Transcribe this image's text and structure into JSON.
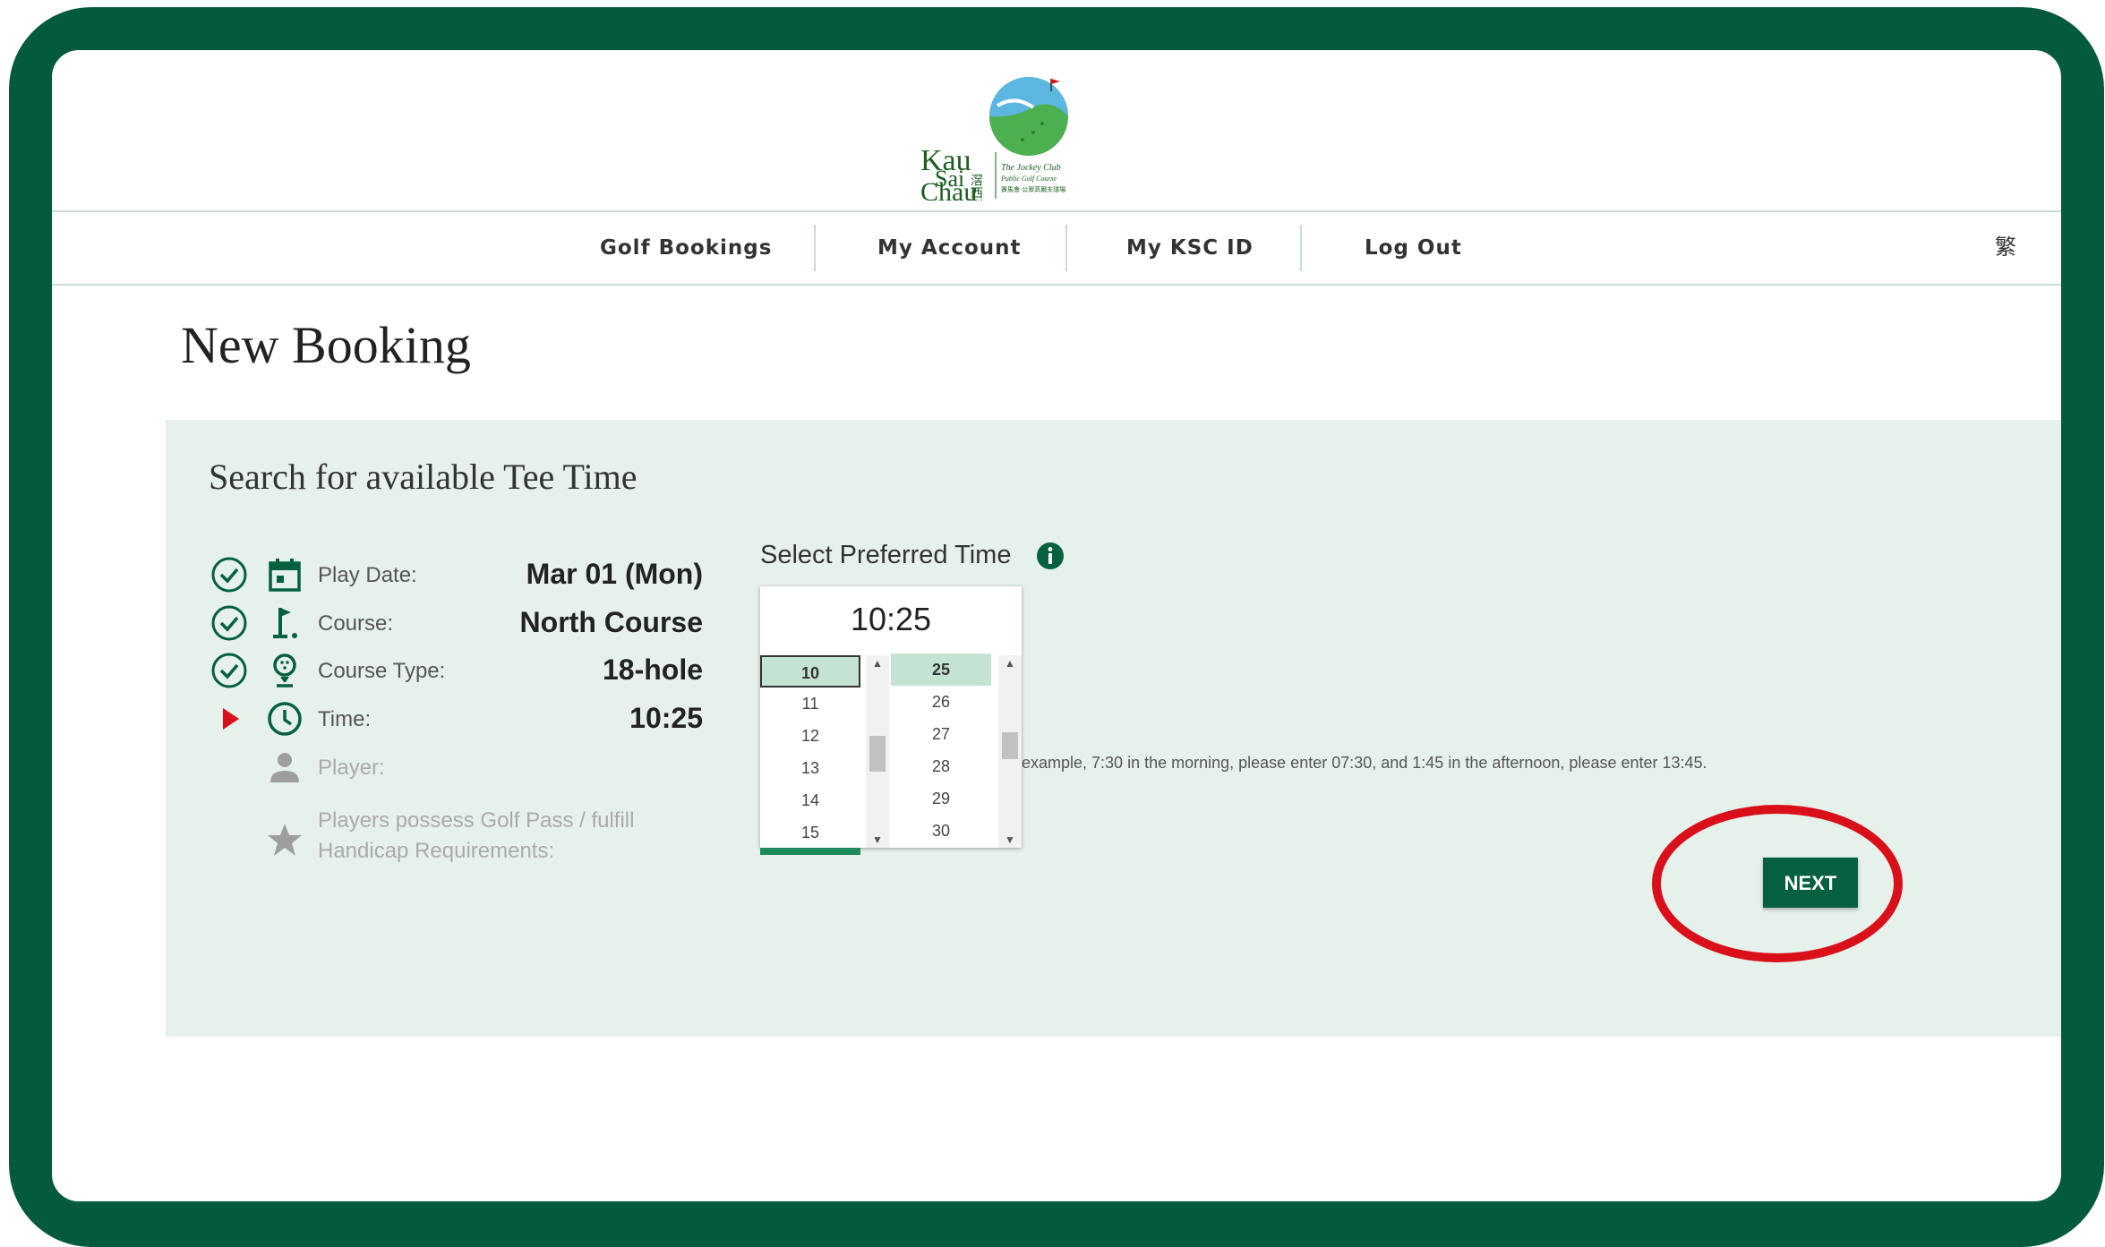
{
  "header": {
    "logo": {
      "line1": "Kau",
      "line2": "Sai",
      "line3": "Chau",
      "chinese": "滘西洲",
      "tagline1": "The Jockey Club",
      "tagline2": "Public Golf Course",
      "tagline3": "賽馬會·公眾高爾夫球場"
    },
    "nav": [
      {
        "label": "Golf Bookings"
      },
      {
        "label": "My Account"
      },
      {
        "label": "My KSC ID"
      },
      {
        "label": "Log Out"
      }
    ],
    "language_toggle": "繁"
  },
  "page": {
    "title": "New Booking"
  },
  "search": {
    "title": "Search for available Tee Time",
    "steps": [
      {
        "label": "Play Date:",
        "value": "Mar 01 (Mon)",
        "status": "done",
        "icon": "calendar-icon"
      },
      {
        "label": "Course:",
        "value": "North Course",
        "status": "done",
        "icon": "flag-icon"
      },
      {
        "label": "Course Type:",
        "value": "18-hole",
        "status": "done",
        "icon": "golf-ball-icon"
      },
      {
        "label": "Time:",
        "value": "10:25",
        "status": "current",
        "icon": "clock-icon"
      },
      {
        "label": "Player:",
        "value": "",
        "status": "pending",
        "icon": "person-icon"
      },
      {
        "label": "Players possess Golf Pass / fulfill",
        "label2": "Handicap Requirements:",
        "value": "",
        "status": "pending",
        "icon": "star-icon"
      }
    ],
    "preferred_time": {
      "label": "Select Preferred Time",
      "display": "10:25",
      "hours": [
        "10",
        "11",
        "12",
        "13",
        "14",
        "15"
      ],
      "selected_hour": "10",
      "minutes": [
        "25",
        "26",
        "27",
        "28",
        "29",
        "30"
      ],
      "selected_minute": "25"
    },
    "hint": "example, 7:30 in the morning, please enter 07:30, and 1:45 in the afternoon, please enter 13:45.",
    "next_label": "NEXT"
  },
  "colors": {
    "brand_green": "#05603f",
    "frame_green": "#045a3c",
    "panel_bg": "#e6f1eb",
    "highlight_red": "#d9101a"
  }
}
